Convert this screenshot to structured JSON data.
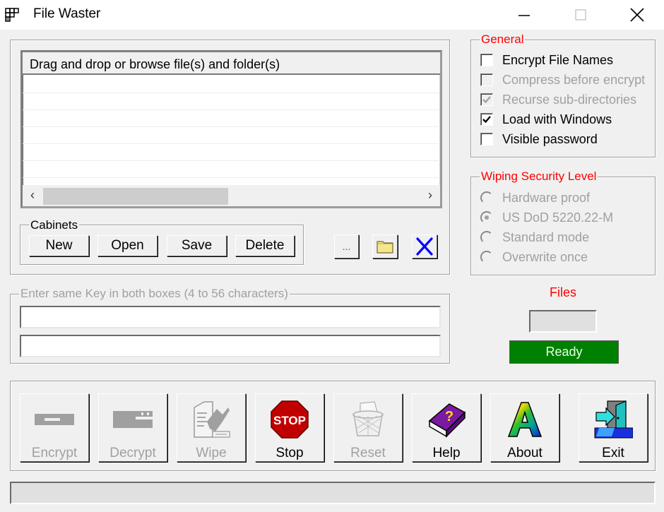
{
  "window": {
    "title": "File Waster",
    "icon": "grid-app-icon",
    "controls": {
      "minimize": "—",
      "maximize": "☐",
      "close": "✕"
    }
  },
  "file_list": {
    "header": "Drag and drop or browse file(s) and folder(s)",
    "rows": [],
    "scroll_left": "‹",
    "scroll_right": "›"
  },
  "cabinets": {
    "title": "Cabinets",
    "buttons": [
      {
        "label": "New"
      },
      {
        "label": "Open"
      },
      {
        "label": "Save"
      },
      {
        "label": "Delete"
      }
    ]
  },
  "list_tools": {
    "browse_label": "...",
    "folder_icon": "folder-icon",
    "clear_icon": "blue-x-icon"
  },
  "general": {
    "title": "General",
    "options": [
      {
        "label": "Encrypt File Names",
        "checked": false,
        "enabled": true
      },
      {
        "label": "Compress before encrypt",
        "checked": false,
        "enabled": false
      },
      {
        "label": "Recurse sub-directories",
        "checked": true,
        "enabled": false
      },
      {
        "label": "Load with Windows",
        "checked": true,
        "enabled": true
      },
      {
        "label": "Visible password",
        "checked": false,
        "enabled": true
      }
    ]
  },
  "wiping": {
    "title": "Wiping Security Level",
    "options": [
      {
        "label": "Hardware proof",
        "selected": false
      },
      {
        "label": "US DoD 5220.22-M",
        "selected": true
      },
      {
        "label": "Standard mode",
        "selected": false
      },
      {
        "label": "Overwrite once",
        "selected": false
      }
    ],
    "enabled": false
  },
  "key_entry": {
    "title": "Enter same Key in both boxes (4 to 56 characters)",
    "key1_value": "",
    "key2_value": ""
  },
  "files": {
    "label": "Files",
    "count": "",
    "status": "Ready",
    "status_color": "#008000"
  },
  "actions": [
    {
      "label": "Encrypt",
      "icon": "encrypt-icon",
      "enabled": false
    },
    {
      "label": "Decrypt",
      "icon": "decrypt-icon",
      "enabled": false
    },
    {
      "label": "Wipe",
      "icon": "wipe-shredder-icon",
      "enabled": false
    },
    {
      "label": "Stop",
      "icon": "stop-sign-icon",
      "enabled": true
    },
    {
      "label": "Reset",
      "icon": "wastebasket-icon",
      "enabled": false
    },
    {
      "label": "Help",
      "icon": "help-book-icon",
      "enabled": true
    },
    {
      "label": "About",
      "icon": "rainbow-a-icon",
      "enabled": true
    },
    {
      "label": "Exit",
      "icon": "exit-door-icon",
      "enabled": true
    }
  ],
  "statusbar": {
    "text": ""
  },
  "colors": {
    "accent_red": "#ff0000",
    "ready_green": "#008000",
    "clear_blue": "#0000ff"
  }
}
